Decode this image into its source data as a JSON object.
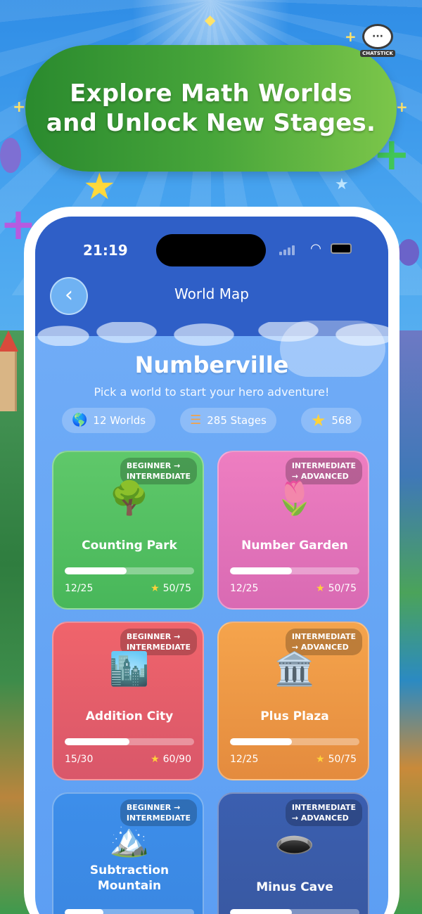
{
  "banner": {
    "line1": "Explore Math Worlds",
    "line2": "and Unlock New Stages."
  },
  "logo": {
    "text": "CHATSTICK"
  },
  "status_bar": {
    "time": "21:19"
  },
  "nav": {
    "title": "World Map",
    "back_icon": "chevron-left-icon"
  },
  "header": {
    "title": "Numberville",
    "subtitle": "Pick a world to start your hero adventure!"
  },
  "stats": [
    {
      "icon": "globe-icon",
      "glyph": "🌎",
      "label": "12 Worlds"
    },
    {
      "icon": "list-icon",
      "glyph": "☰",
      "label": "285 Stages"
    },
    {
      "icon": "star-icon",
      "glyph": "★",
      "label": "568"
    }
  ],
  "worlds": [
    {
      "name": "Counting Park",
      "tag_line1": "BEGINNER →",
      "tag_line2": "INTERMEDIATE",
      "icon": "tree-icon",
      "glyph": "🌳",
      "stages": "12/25",
      "stars": "50/75",
      "progress": 0.48,
      "color_top": "#5fc86a",
      "color_bottom": "#48b75a"
    },
    {
      "name": "Number Garden",
      "tag_line1": "INTERMEDIATE",
      "tag_line2": "→ ADVANCED",
      "icon": "tulip-icon",
      "glyph": "🌷",
      "stages": "12/25",
      "stars": "50/75",
      "progress": 0.48,
      "color_top": "#ee7ec1",
      "color_bottom": "#d96ab3"
    },
    {
      "name": "Addition City",
      "tag_line1": "BEGINNER →",
      "tag_line2": "INTERMEDIATE",
      "icon": "city-icon",
      "glyph": "🏙️",
      "stages": "15/30",
      "stars": "60/90",
      "progress": 0.5,
      "color_top": "#f0646b",
      "color_bottom": "#d9576a"
    },
    {
      "name": "Plus Plaza",
      "tag_line1": "INTERMEDIATE",
      "tag_line2": "→ ADVANCED",
      "icon": "classical-building-icon",
      "glyph": "🏛️",
      "stages": "12/25",
      "stars": "50/75",
      "progress": 0.48,
      "color_top": "#f5a44c",
      "color_bottom": "#e48b3e"
    },
    {
      "name_line1": "Subtraction",
      "name_line2": "Mountain",
      "tag_line1": "BEGINNER →",
      "tag_line2": "INTERMEDIATE",
      "icon": "mountain-icon",
      "glyph": "🏔️",
      "stages": "",
      "stars": "",
      "progress": 0.3,
      "color_top": "#3d8eea",
      "color_bottom": "#3a86e0"
    },
    {
      "name": "Minus Cave",
      "tag_line1": "INTERMEDIATE",
      "tag_line2": "→ ADVANCED",
      "icon": "hole-icon",
      "glyph": "🕳️",
      "stages": "",
      "stars": "",
      "progress": 0.48,
      "color_top": "#3b5fb0",
      "color_bottom": "#38579f"
    }
  ]
}
